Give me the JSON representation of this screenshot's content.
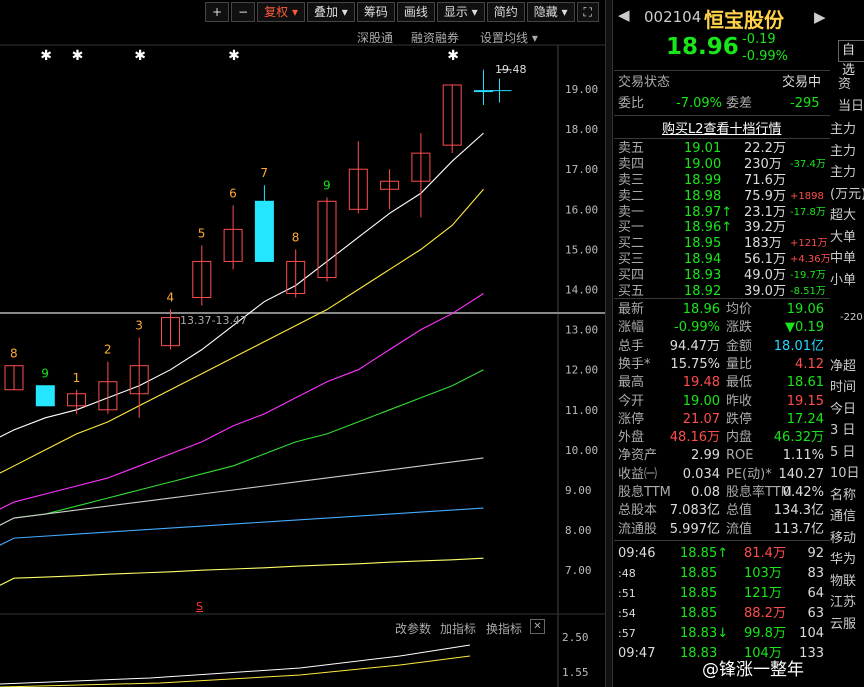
{
  "colors": {
    "up": "#ff4d4d",
    "down": "#19e619",
    "accent": "#ff5b3a",
    "price_line": "#ddd"
  },
  "toolbar": {
    "buttons": [
      "+",
      "−",
      "复权 ▾",
      "叠加 ▾",
      "筹码",
      "画线",
      "显示 ▾",
      "简约",
      "隐藏 ▾",
      "⛶"
    ]
  },
  "chart_links": [
    "深股通",
    "融资融券",
    "设置均线 ▾"
  ],
  "price_tag": "19.48",
  "range_label": "13.37-13.47",
  "sig_marker": "S",
  "indicator_links": [
    "改参数",
    "加指标",
    "换指标"
  ],
  "indicator_close": "✕",
  "chart_data": {
    "type": "candlestick",
    "yaxis_ticks": [
      "19.00",
      "18.00",
      "17.00",
      "16.00",
      "15.00",
      "14.00",
      "13.00",
      "12.00",
      "11.00",
      "10.00",
      "9.00",
      "8.00",
      "7.00"
    ],
    "ylim": [
      6.5,
      19.8
    ],
    "candles": [
      {
        "o": 11.5,
        "c": 12.1,
        "h": 12.1,
        "l": 11.5,
        "count": "8"
      },
      {
        "o": 11.6,
        "c": 11.1,
        "h": 11.6,
        "l": 11.1,
        "count": "9"
      },
      {
        "o": 11.1,
        "c": 11.4,
        "h": 11.5,
        "l": 10.9,
        "count": "1"
      },
      {
        "o": 11.0,
        "c": 11.7,
        "h": 12.2,
        "l": 10.9,
        "count": "2"
      },
      {
        "o": 11.4,
        "c": 12.1,
        "h": 12.8,
        "l": 10.8,
        "count": "3"
      },
      {
        "o": 12.6,
        "c": 13.3,
        "h": 13.5,
        "l": 12.5,
        "count": "4"
      },
      {
        "o": 13.8,
        "c": 14.7,
        "h": 15.1,
        "l": 13.6,
        "count": "5"
      },
      {
        "o": 14.7,
        "c": 15.5,
        "h": 16.1,
        "l": 14.5,
        "count": "6"
      },
      {
        "o": 16.2,
        "c": 14.7,
        "h": 16.6,
        "l": 14.7,
        "count": "7"
      },
      {
        "o": 13.9,
        "c": 14.7,
        "h": 15.0,
        "l": 13.8,
        "count": "8"
      },
      {
        "o": 14.3,
        "c": 16.2,
        "h": 16.3,
        "l": 14.2,
        "count": "9"
      },
      {
        "o": 16.0,
        "c": 17.0,
        "h": 17.7,
        "l": 15.9,
        "count": ""
      },
      {
        "o": 16.5,
        "c": 16.7,
        "h": 17.0,
        "l": 16.0,
        "count": ""
      },
      {
        "o": 16.7,
        "c": 17.4,
        "h": 17.9,
        "l": 15.8,
        "count": ""
      },
      {
        "o": 17.6,
        "c": 19.1,
        "h": 19.1,
        "l": 17.4,
        "count": ""
      },
      {
        "o": 18.96,
        "c": 18.96,
        "h": 19.48,
        "l": 18.6,
        "count": ""
      }
    ],
    "star_candles": [
      1,
      2,
      4,
      7,
      14
    ],
    "ma": [
      {
        "color": "#ffffff",
        "values": [
          10.5,
          10.8,
          11.0,
          11.3,
          11.6,
          12.0,
          12.5,
          13.1,
          13.7,
          14.1,
          14.7,
          15.3,
          15.9,
          16.4,
          17.2,
          17.9
        ]
      },
      {
        "color": "#ffea3d",
        "values": [
          9.6,
          10.0,
          10.4,
          10.7,
          11.1,
          11.5,
          11.9,
          12.3,
          12.7,
          13.1,
          13.5,
          14.0,
          14.5,
          15.0,
          15.6,
          16.5
        ]
      },
      {
        "color": "#ff33ff",
        "values": [
          8.7,
          8.9,
          9.1,
          9.3,
          9.6,
          9.9,
          10.2,
          10.6,
          10.9,
          11.3,
          11.7,
          12.0,
          12.5,
          13.0,
          13.4,
          13.9
        ]
      },
      {
        "color": "#33dd33",
        "values": [
          8.3,
          8.4,
          8.6,
          8.8,
          9.0,
          9.2,
          9.4,
          9.6,
          9.9,
          10.2,
          10.4,
          10.7,
          11.0,
          11.3,
          11.6,
          12.0
        ]
      },
      {
        "color": "#cccccc",
        "values": [
          8.3,
          8.4,
          8.5,
          8.6,
          8.7,
          8.8,
          8.9,
          9.0,
          9.1,
          9.2,
          9.3,
          9.4,
          9.5,
          9.6,
          9.7,
          9.8
        ]
      },
      {
        "color": "#44aaff",
        "values": [
          7.8,
          7.85,
          7.9,
          7.95,
          8.0,
          8.05,
          8.1,
          8.15,
          8.2,
          8.25,
          8.3,
          8.35,
          8.4,
          8.45,
          8.5,
          8.55
        ]
      },
      {
        "color": "#ffff66",
        "values": [
          6.8,
          6.83,
          6.86,
          6.9,
          6.93,
          6.96,
          7.0,
          7.03,
          7.06,
          7.1,
          7.13,
          7.16,
          7.2,
          7.23,
          7.26,
          7.3
        ]
      }
    ]
  },
  "indicator_ticks": [
    "2.50",
    "1.55"
  ],
  "stock": {
    "code": "002104",
    "name": "恒宝股份",
    "price": "18.96",
    "chg": "-0.19",
    "pct": "-0.99%",
    "fav": "自选"
  },
  "status": {
    "label": "交易状态",
    "value": "交易中",
    "wb_label": "委比",
    "wb": "-7.09%",
    "wc_label": "委差",
    "wc": "-295"
  },
  "l2_banner": "购买L2查看十档行情",
  "asks": [
    {
      "label": "卖五",
      "price": "19.01",
      "vol": "22.2万",
      "chg": ""
    },
    {
      "label": "卖四",
      "price": "19.00",
      "vol": "230万",
      "chg": "-37.4万"
    },
    {
      "label": "卖三",
      "price": "18.99",
      "vol": "71.6万",
      "chg": ""
    },
    {
      "label": "卖二",
      "price": "18.98",
      "vol": "75.9万",
      "chg": "+1898"
    },
    {
      "label": "卖一",
      "price": "18.97↑",
      "vol": "23.1万",
      "chg": "-17.8万"
    }
  ],
  "bids": [
    {
      "label": "买一",
      "price": "18.96↑",
      "vol": "39.2万",
      "chg": ""
    },
    {
      "label": "买二",
      "price": "18.95",
      "vol": "183万",
      "chg": "+121万"
    },
    {
      "label": "买三",
      "price": "18.94",
      "vol": "56.1万",
      "chg": "+4.36万"
    },
    {
      "label": "买四",
      "price": "18.93",
      "vol": "49.0万",
      "chg": "-19.7万"
    },
    {
      "label": "买五",
      "price": "18.92",
      "vol": "39.0万",
      "chg": "-8.51万"
    }
  ],
  "stats": [
    [
      "最新",
      "18.96",
      "均价",
      "19.06"
    ],
    [
      "涨幅",
      "-0.99%",
      "涨跌",
      "▼0.19"
    ],
    [
      "总手",
      "94.47万",
      "金额",
      "18.01亿"
    ],
    [
      "换手*",
      "15.75%",
      "量比",
      "4.12"
    ],
    [
      "最高",
      "19.48",
      "最低",
      "18.61"
    ],
    [
      "今开",
      "19.00",
      "昨收",
      "19.15"
    ],
    [
      "涨停",
      "21.07",
      "跌停",
      "17.24"
    ],
    [
      "外盘",
      "48.16万",
      "内盘",
      "46.32万"
    ],
    [
      "净资产",
      "2.99",
      "ROE",
      "1.11%"
    ],
    [
      "收益㈠",
      "0.034",
      "PE(动)*",
      "140.27"
    ],
    [
      "股息TTM",
      "0.08",
      "股息率TTM",
      "0.42%"
    ],
    [
      "总股本",
      "7.083亿",
      "总值",
      "134.3亿"
    ],
    [
      "流通股",
      "5.997亿",
      "流值",
      "113.7亿"
    ]
  ],
  "ticks": [
    {
      "time": "09:46",
      "price": "18.85↑",
      "vol": "81.4万",
      "n": "92"
    },
    {
      "time": ":48",
      "price": "18.85",
      "vol": "103万",
      "n": "83"
    },
    {
      "time": ":51",
      "price": "18.85",
      "vol": "121万",
      "n": "64"
    },
    {
      "time": ":54",
      "price": "18.85",
      "vol": "88.2万",
      "n": "63"
    },
    {
      "time": ":57",
      "price": "18.83↓",
      "vol": "99.8万",
      "n": "104"
    },
    {
      "time": "09:47",
      "price": "18.83",
      "vol": "104万",
      "n": "133"
    }
  ],
  "side_panel": {
    "tabs": [
      "资",
      "当日"
    ],
    "lines": [
      "主力",
      "主力",
      "主力",
      "(万元)",
      "超大",
      "大单",
      "中单",
      "小单",
      "",
      "-220",
      "",
      "净超",
      "时间",
      "今日",
      "3 日",
      "5 日",
      "10日",
      "名称",
      "通信",
      "移动",
      "华为",
      "物联",
      "江苏",
      "云服"
    ]
  },
  "watermark": "@锋涨一整年"
}
